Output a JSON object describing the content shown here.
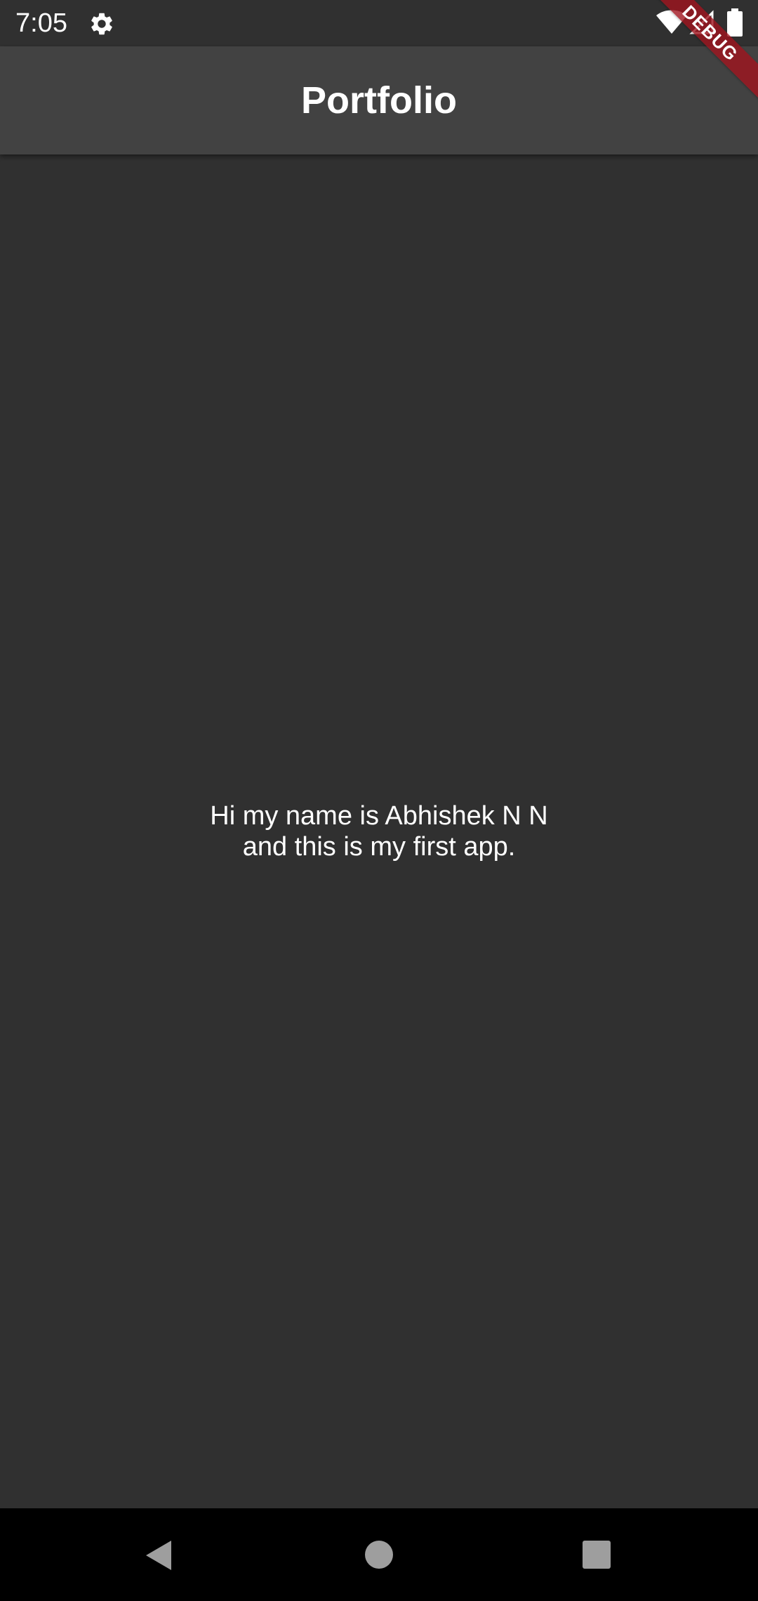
{
  "status_bar": {
    "time": "7:05",
    "icons": [
      "gear-icon",
      "wifi-icon",
      "signal-icon",
      "battery-icon"
    ]
  },
  "app_bar": {
    "title": "Portfolio"
  },
  "debug_banner": {
    "label": "DEBUG"
  },
  "main": {
    "intro_line_1": "Hi my name is Abhishek N N",
    "intro_line_2": "and this is my first app."
  },
  "nav_bar": {
    "icons": [
      "back-icon",
      "home-icon",
      "recents-icon"
    ]
  },
  "colors": {
    "background": "#303030",
    "app_bar": "#424242",
    "nav_bar": "#000000",
    "debug_ribbon": "#a0141e",
    "text": "#ffffff"
  }
}
